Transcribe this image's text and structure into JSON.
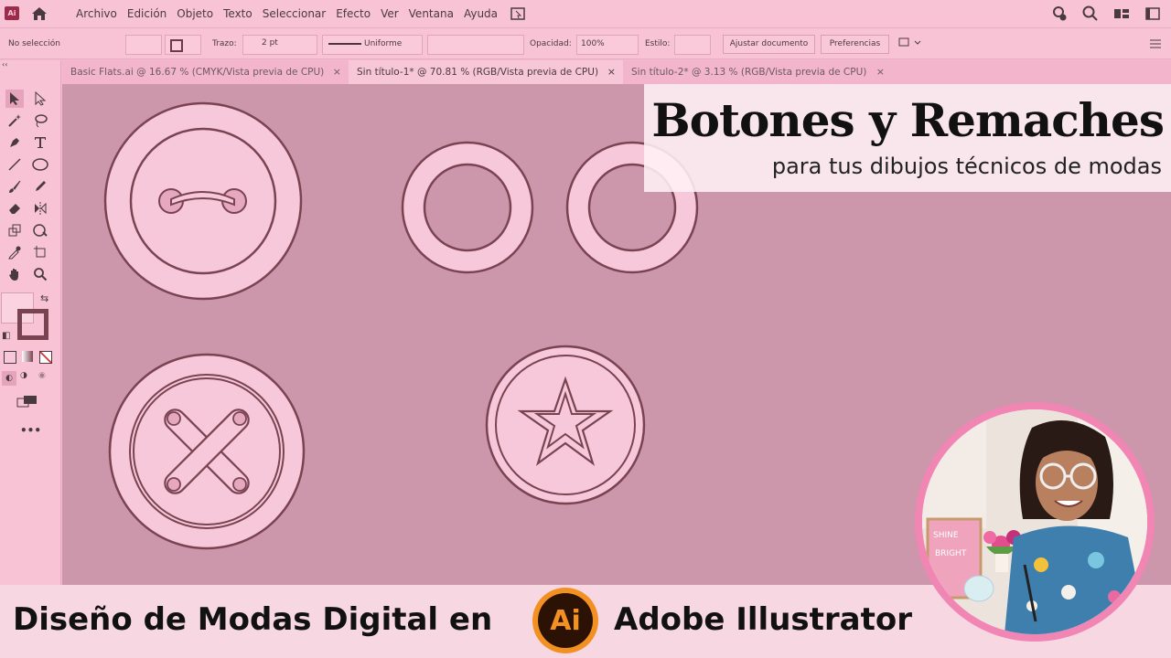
{
  "app": {
    "logo_text": "Ai"
  },
  "menu": [
    "Archivo",
    "Edición",
    "Objeto",
    "Texto",
    "Seleccionar",
    "Efecto",
    "Ver",
    "Ventana",
    "Ayuda"
  ],
  "control": {
    "selection": "No selección",
    "stroke_label": "Trazo:",
    "stroke_value": "2 pt",
    "stroke_profile": "Uniforme",
    "opacity_label": "Opacidad:",
    "opacity_value": "100%",
    "style_label": "Estilo:",
    "fit_button": "Ajustar documento",
    "prefs_button": "Preferencias"
  },
  "tabs": [
    {
      "label": "Basic Flats.ai @ 16.67 % (CMYK/Vista previa de CPU)",
      "close": "×"
    },
    {
      "label": "Sin título-1* @ 70.81 % (RGB/Vista previa de CPU)",
      "close": "×"
    },
    {
      "label": "Sin título-2* @ 3.13 % (RGB/Vista previa de CPU)",
      "close": "×"
    }
  ],
  "overlay": {
    "title": "Botones y Remaches",
    "subtitle": "para tus dibujos técnicos de modas"
  },
  "banner": {
    "left": "Diseño de Modas Digital en",
    "logo": "Ai",
    "right": "Adobe Illustrator"
  },
  "photo": {
    "board_text": "SHINE BRIGHT"
  },
  "toolbar": {
    "more": "•••"
  },
  "colors": {
    "canvas": "#cc97aa",
    "button_fill": "#f7c8da",
    "stroke": "#7a4352",
    "ui": "#f7c3d5"
  }
}
